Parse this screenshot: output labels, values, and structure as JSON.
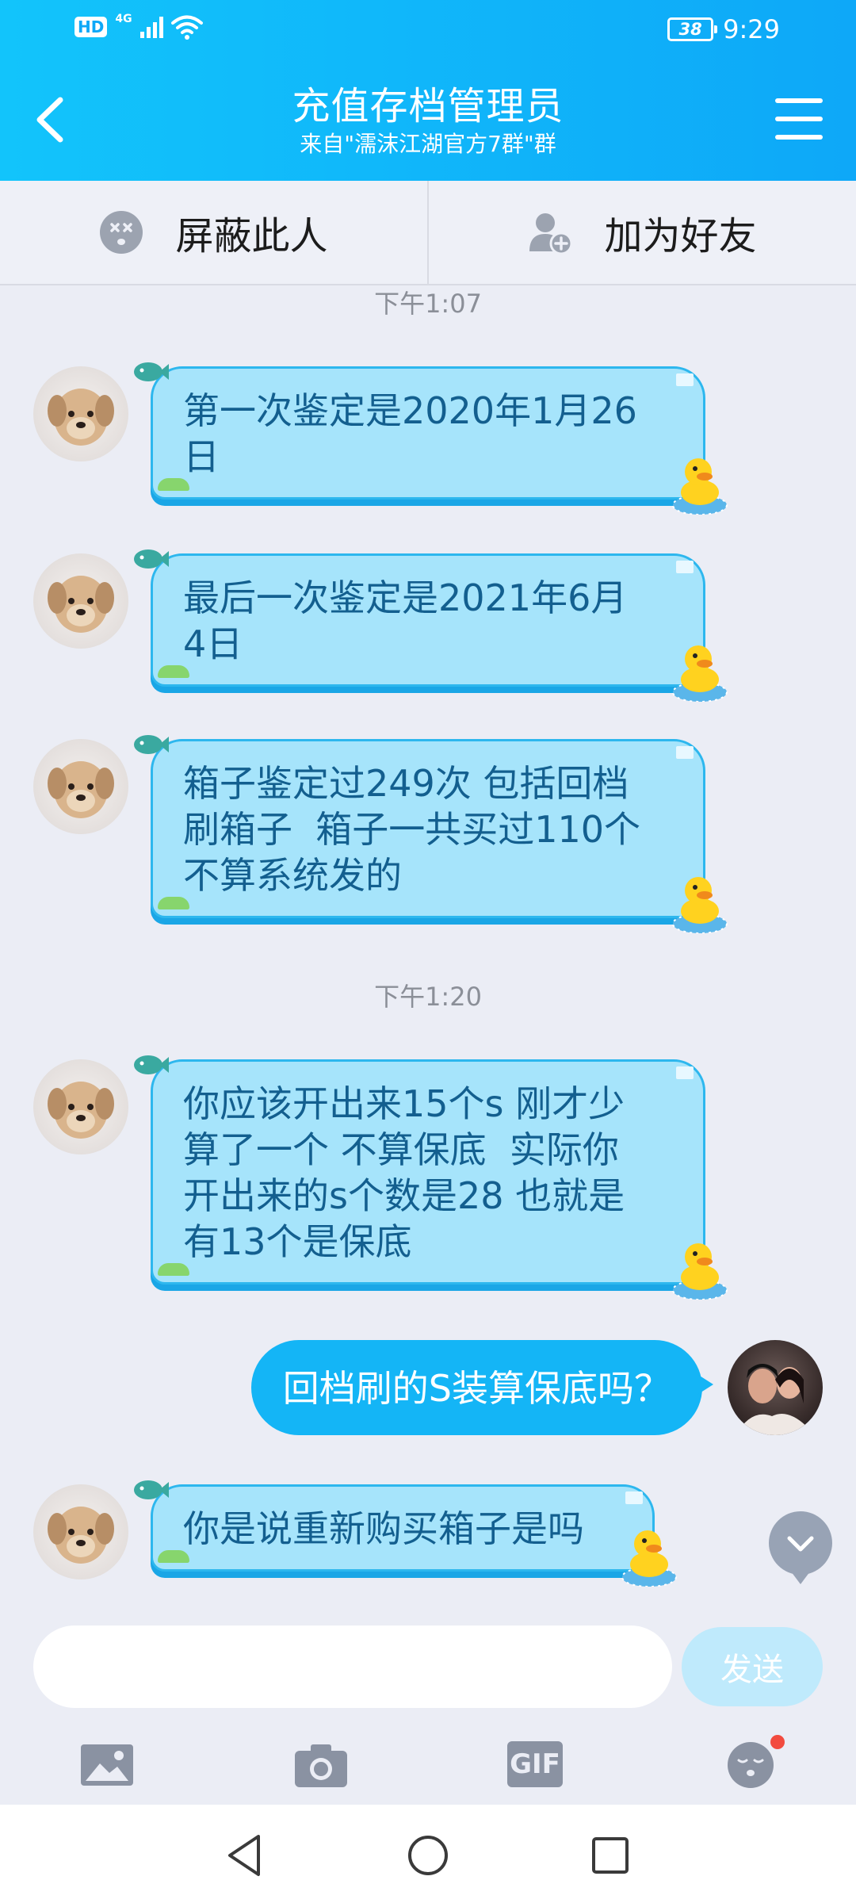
{
  "status_bar": {
    "hd": "HD",
    "network": "4G",
    "battery": "38",
    "time": "9:29"
  },
  "header": {
    "title": "充值存档管理员",
    "subtitle": "来自\"濡沫江湖官方7群\"群"
  },
  "actions": {
    "block_label": "屏蔽此人",
    "add_friend_label": "加为好友"
  },
  "messages": {
    "time1": "下午1:07",
    "msg1_line1": "第一次鉴定是2020年1月26",
    "msg1_line2": "日",
    "msg2_line1": "最后一次鉴定是2021年6月",
    "msg2_line2": "4日",
    "msg3_line1": "箱子鉴定过249次 包括回档",
    "msg3_line2": "刷箱子  箱子一共买过110个",
    "msg3_line3": "不算系统发的",
    "time2": "下午1:20",
    "msg4_line1": "你应该开出来15个s 刚才少",
    "msg4_line2": "算了一个 不算保底  实际你",
    "msg4_line3": "开出来的s个数是28 也就是",
    "msg4_line4": "有13个是保底",
    "msg5": "回档刷的S装算保底吗？",
    "msg6": "你是说重新购买箱子是吗"
  },
  "input": {
    "value": "",
    "send_label": "发送"
  },
  "tools": {
    "gif_label": "GIF"
  },
  "colors": {
    "header_start": "#12c4fb",
    "header_end": "#0ea8f8",
    "incoming_bubble": "#a6e4fb",
    "incoming_text": "#135f8f",
    "outgoing_bubble": "#14b5f6",
    "send_button": "#bfeafc"
  },
  "icons": {
    "back": "chevron-left-icon",
    "menu": "hamburger-menu-icon",
    "block": "blocked-face-icon",
    "add_friend": "add-person-icon",
    "image": "image-icon",
    "camera": "camera-icon",
    "emoji": "emoji-icon",
    "scroll_down": "chevron-down-icon"
  }
}
